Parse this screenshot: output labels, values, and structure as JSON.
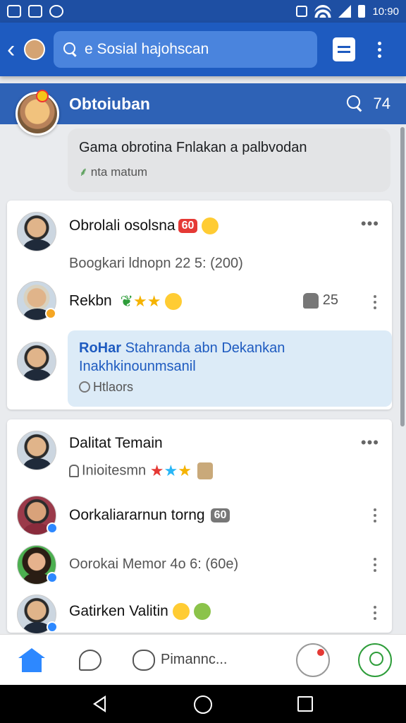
{
  "status_bar": {
    "time": "10:90"
  },
  "app_bar": {
    "search_text": "e Sosial hajohscan"
  },
  "group": {
    "title": "Obtoiuban",
    "count": "74"
  },
  "pinned": {
    "title": "Gama obrotina Fnlakan a palbvodan",
    "sub": "nta matum"
  },
  "card1": {
    "post_name": "Obrolali osolsna",
    "post_badge": "60",
    "post_sub": "Boogkari ldnopn 22 5: (200)",
    "reaction_name": "Rekbn",
    "reaction_count": "25",
    "reply_author": "RoHar",
    "reply_text_1": "Stahranda abn Dekankan",
    "reply_text_2": "Inakhkinounmsanil",
    "reply_sub": "Htlaors"
  },
  "card2": {
    "title": "Dalitat Temain",
    "title_sub": "Inioitesmn",
    "row1_name": "Oorkaliararnun torng",
    "row1_badge": "60",
    "row2_sub": "Oorokai Memor 4o 6: (60e)",
    "row3_name": "Gatirken Valitin"
  },
  "bottom_nav": {
    "groups_label": "Pimannc..."
  },
  "colors": {
    "primary": "#1e5bc0",
    "accent": "#2d88ff",
    "badge_red": "#e53935"
  },
  "icons": [
    "back-icon",
    "search-icon",
    "document-icon",
    "more-icon",
    "home-icon",
    "chat-icon",
    "groups-icon",
    "notifications-icon",
    "profile-icon"
  ]
}
